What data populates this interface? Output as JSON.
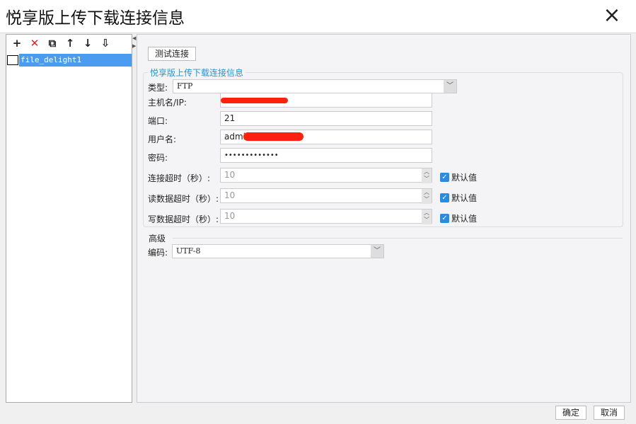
{
  "window": {
    "title": "悦享版上传下载连接信息",
    "close_icon": "×"
  },
  "toolbar": {
    "add": "+",
    "delete": "✕",
    "copy": "⧉",
    "up": "↑",
    "down": "↓",
    "sort": "⇩"
  },
  "tree": {
    "items": [
      {
        "label": "file_delight1"
      }
    ]
  },
  "main": {
    "test_button": "测试连接",
    "group_title": "悦享版上传下载连接信息",
    "fields": {
      "type_label": "类型:",
      "type_value": "FTP",
      "host_label": "主机名/IP:",
      "host_value": "",
      "port_label": "端口:",
      "port_value": "21",
      "user_label": "用户名:",
      "user_value": "admi",
      "password_label": "密码:",
      "password_value": "•••••••••••••"
    },
    "timeouts": [
      {
        "label": "连接超时（秒）:",
        "value": "10",
        "default_label": "默认值",
        "checked": true
      },
      {
        "label": "读数据超时（秒）:",
        "value": "10",
        "default_label": "默认值",
        "checked": true
      },
      {
        "label": "写数据超时（秒）:",
        "value": "10",
        "default_label": "默认值",
        "checked": true
      }
    ],
    "advanced_title": "高级",
    "encoding_label": "编码:",
    "encoding_value": "UTF-8"
  },
  "footer": {
    "ok": "确定",
    "cancel": "取消"
  }
}
